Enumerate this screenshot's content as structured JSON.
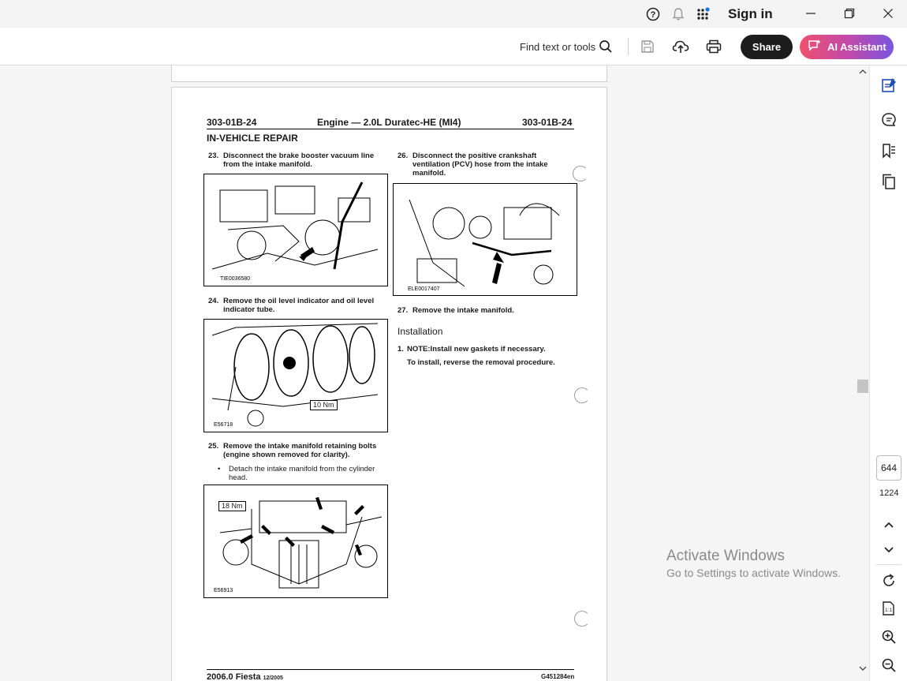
{
  "titlebar": {
    "signin": "Sign in"
  },
  "toolbar": {
    "find_label": "Find text or tools",
    "share_label": "Share",
    "ai_label": "AI Assistant"
  },
  "document": {
    "header": {
      "left": "303-01B-24",
      "middle": "Engine — 2.0L Duratec-HE (MI4)",
      "right": "303-01B-24"
    },
    "section": "IN-VEHICLE REPAIR",
    "steps": {
      "s23": {
        "num": "23.",
        "text": "Disconnect the brake booster vacuum line from the intake manifold."
      },
      "s24": {
        "num": "24.",
        "text": "Remove the oil level indicator and oil level indicator tube."
      },
      "s25": {
        "num": "25.",
        "text": "Remove the intake manifold retaining bolts (engine shown removed for clarity)."
      },
      "s25_bullet": "Detach the intake manifold from the cylinder head.",
      "s26": {
        "num": "26.",
        "text": "Disconnect the positive crankshaft ventilation (PCV) hose from the intake manifold."
      },
      "s27": {
        "num": "27.",
        "text": "Remove the intake manifold."
      }
    },
    "installation": {
      "heading": "Installation",
      "step1_num": "1.",
      "step1_text": "NOTE:Install new gaskets if necessary.",
      "step1_sub": "To install, reverse the removal procedure."
    },
    "figures": {
      "fig1_label": "TIE0036580",
      "fig2_label": "E56718",
      "fig2_torque": "10 Nm",
      "fig3_label": "E56913",
      "fig3_torque": "18 Nm",
      "fig4_label": "ELE0017407"
    },
    "footer": {
      "left": "2006.0 Fiesta",
      "left_small": "12/2005",
      "right": "G451284en"
    }
  },
  "watermark": {
    "line1": "Activate Windows",
    "line2": "Go to Settings to activate Windows."
  },
  "pagination": {
    "current": "644",
    "total": "1224"
  }
}
